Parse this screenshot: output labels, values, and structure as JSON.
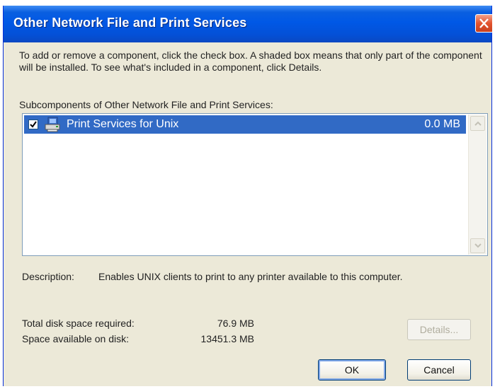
{
  "window": {
    "title": "Other Network File and Print Services"
  },
  "instruction": "To add or remove a component, click the check box. A shaded box means that only part of the component will be installed. To see what's included in a component, click Details.",
  "subcomponents_label": "Subcomponents of Other Network File and Print Services:",
  "components": [
    {
      "name": "Print Services for Unix",
      "size": "0.0 MB",
      "checked": true,
      "selected": true,
      "icon": "printer-computer-icon"
    }
  ],
  "description": {
    "label": "Description:",
    "text": "Enables UNIX clients to print to any printer available to this computer."
  },
  "disk_space": {
    "required_label": "Total disk space required:",
    "required_value": "76.9 MB",
    "available_label": "Space available on disk:",
    "available_value": "13451.3 MB"
  },
  "buttons": {
    "details": "Details...",
    "ok": "OK",
    "cancel": "Cancel"
  },
  "colors": {
    "titlebar": "#0058e6",
    "selection": "#316ac5",
    "dialog_bg": "#ece9d8",
    "close_button": "#e2532e"
  }
}
